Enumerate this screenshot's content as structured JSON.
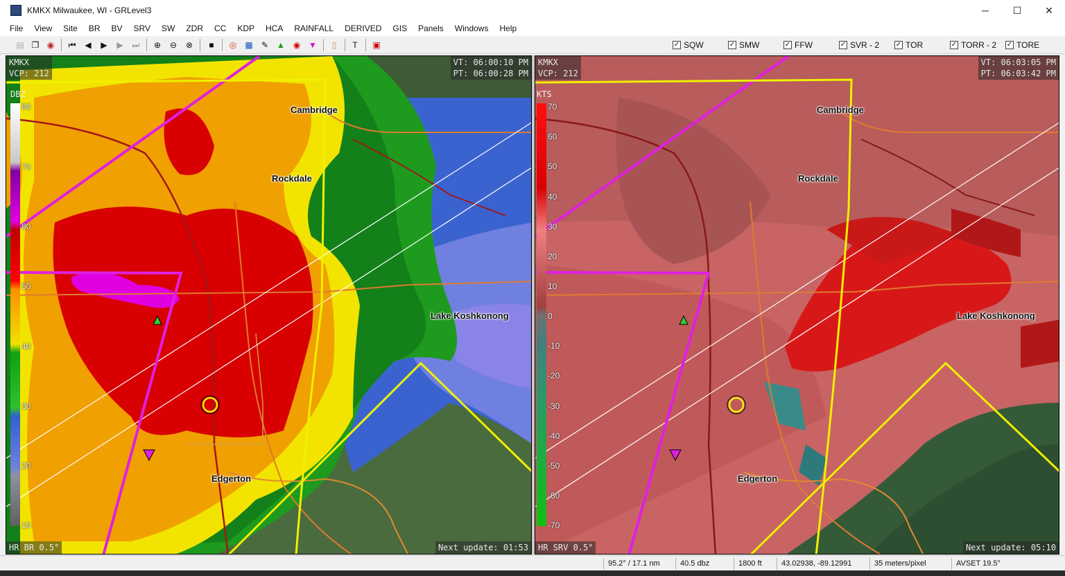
{
  "window": {
    "title": "KMKX Milwaukee, WI - GRLevel3"
  },
  "window_controls": {
    "minimize": "─",
    "maximize": "☐",
    "close": "✕"
  },
  "menu": [
    "File",
    "View",
    "Site",
    "BR",
    "BV",
    "SRV",
    "SW",
    "ZDR",
    "CC",
    "KDP",
    "HCA",
    "RAINFALL",
    "DERIVED",
    "GIS",
    "Panels",
    "Windows",
    "Help"
  ],
  "warnings": [
    {
      "label": "SQW",
      "checked": "✓"
    },
    {
      "label": "SMW",
      "checked": "✓"
    },
    {
      "label": "FFW",
      "checked": "✓"
    },
    {
      "label": "SVR - 2",
      "checked": "✓"
    },
    {
      "label": "TOR",
      "checked": "✓"
    },
    {
      "label": "TORR - 2",
      "checked": "✓"
    },
    {
      "label": "TORE",
      "checked": "✓"
    }
  ],
  "left_panel": {
    "site": "KMKX",
    "vcp": "VCP: 212",
    "vt": "VT: 06:00:10 PM",
    "pt": "PT: 06:00:28 PM",
    "product": "HR BR 0.5°",
    "next_update": "Next update: 01:53",
    "legend_unit": "DBZ",
    "legend_ticks": [
      "80",
      "70",
      "60",
      "50",
      "40",
      "30",
      "20",
      "10"
    ]
  },
  "right_panel": {
    "site": "KMKX",
    "vcp": "VCP: 212",
    "vt": "VT: 06:03:05 PM",
    "pt": "PT: 06:03:42 PM",
    "product": "HR SRV 0.5°",
    "next_update": "Next update: 05:10",
    "legend_unit": "KTS",
    "legend_ticks": [
      "70",
      "60",
      "50",
      "40",
      "30",
      "20",
      "10",
      "0",
      "-10",
      "-20",
      "-30",
      "-40",
      "-50",
      "-60",
      "-70"
    ]
  },
  "cities": {
    "cambridge": "Cambridge",
    "rockdale": "Rockdale",
    "lake": "Lake Koshkonong",
    "edgerton": "Edgerton"
  },
  "status": {
    "azimuth": "95.2° / 17.1 nm",
    "value": "40.5 dbz",
    "height": "1800 ft",
    "coords": "43.02938, -89.12991",
    "resolution": "35 meters/pixel",
    "avset": "AVSET 19.5°"
  },
  "colors": {
    "reflectivity_red": "#d80000",
    "reflectivity_yellow": "#f0e000",
    "reflectivity_green": "#1a9a1a",
    "velocity_red": "#e06060",
    "warning_magenta": "#e020e0",
    "warning_yellow": "#f0f000"
  }
}
